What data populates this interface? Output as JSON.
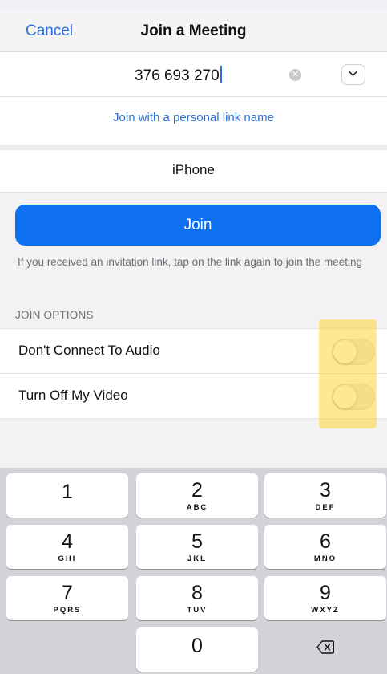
{
  "nav": {
    "cancel_label": "Cancel",
    "title": "Join a Meeting"
  },
  "meeting": {
    "id_value": "376 693 270",
    "clear_icon": "clear-circle-icon",
    "dropdown_icon": "chevron-down-icon"
  },
  "personal_link_label": "Join with a personal link name",
  "name_value": "iPhone",
  "join_button_label": "Join",
  "hint_text": "If you received an invitation link, tap on the link again to join the meeting",
  "join_options": {
    "header": "JOIN OPTIONS",
    "items": [
      {
        "label": "Don't Connect To Audio",
        "enabled": false
      },
      {
        "label": "Turn Off My Video",
        "enabled": false
      }
    ]
  },
  "colors": {
    "accent": "#0e6ff0",
    "link": "#2d6fd8",
    "highlight": "#ffd633"
  },
  "keypad": {
    "keys": [
      {
        "digit": "1",
        "letters": ""
      },
      {
        "digit": "2",
        "letters": "ABC"
      },
      {
        "digit": "3",
        "letters": "DEF"
      },
      {
        "digit": "4",
        "letters": "GHI"
      },
      {
        "digit": "5",
        "letters": "JKL"
      },
      {
        "digit": "6",
        "letters": "MNO"
      },
      {
        "digit": "7",
        "letters": "PQRS"
      },
      {
        "digit": "8",
        "letters": "TUV"
      },
      {
        "digit": "9",
        "letters": "WXYZ"
      },
      {
        "digit": "0",
        "letters": ""
      }
    ],
    "delete_icon": "backspace-icon"
  }
}
